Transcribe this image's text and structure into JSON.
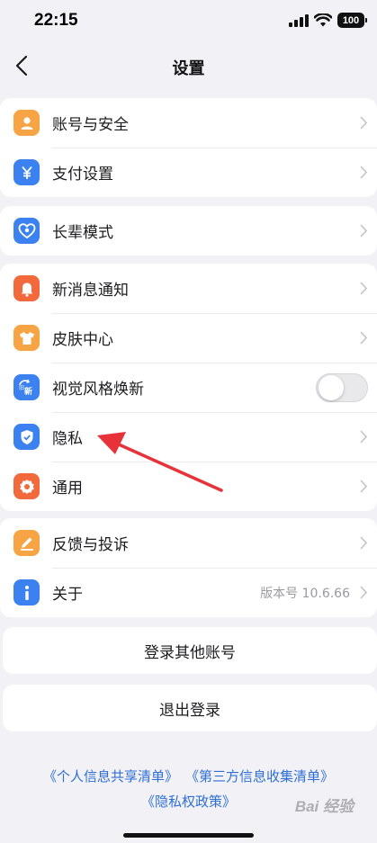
{
  "status_bar": {
    "time": "22:15",
    "battery": "100"
  },
  "nav": {
    "title": "设置"
  },
  "groups": {
    "account": {
      "items": [
        {
          "label": "账号与安全",
          "icon": "person-icon",
          "color": "#f7a444"
        },
        {
          "label": "支付设置",
          "icon": "yuan-icon",
          "color": "#3b82f0"
        }
      ]
    },
    "elder": {
      "items": [
        {
          "label": "长辈模式",
          "icon": "heart-icon",
          "color": "#3b82f0"
        }
      ]
    },
    "general": {
      "items": [
        {
          "label": "新消息通知",
          "icon": "bell-icon",
          "color": "#f26a3c"
        },
        {
          "label": "皮肤中心",
          "icon": "shirt-icon",
          "color": "#f7a444"
        },
        {
          "label": "视觉风格焕新",
          "icon": "refresh-new-icon",
          "color": "#3b82f0",
          "toggle": false
        },
        {
          "label": "隐私",
          "icon": "shield-icon",
          "color": "#3b82f0"
        },
        {
          "label": "通用",
          "icon": "gear-icon",
          "color": "#f26a3c"
        }
      ]
    },
    "about": {
      "items": [
        {
          "label": "反馈与投诉",
          "icon": "edit-icon",
          "color": "#f7a444"
        },
        {
          "label": "关于",
          "icon": "info-icon",
          "color": "#3b82f0",
          "value": "版本号 10.6.66"
        }
      ]
    }
  },
  "buttons": {
    "login_other": "登录其他账号",
    "logout": "退出登录"
  },
  "links": {
    "personal_info": "《个人信息共享清单》",
    "third_party": "《第三方信息收集清单》",
    "privacy_policy": "《隐私权政策》"
  },
  "watermark": "Bai 经验",
  "colors": {
    "annotation_arrow": "#e8323a",
    "link": "#2f6fd4"
  }
}
